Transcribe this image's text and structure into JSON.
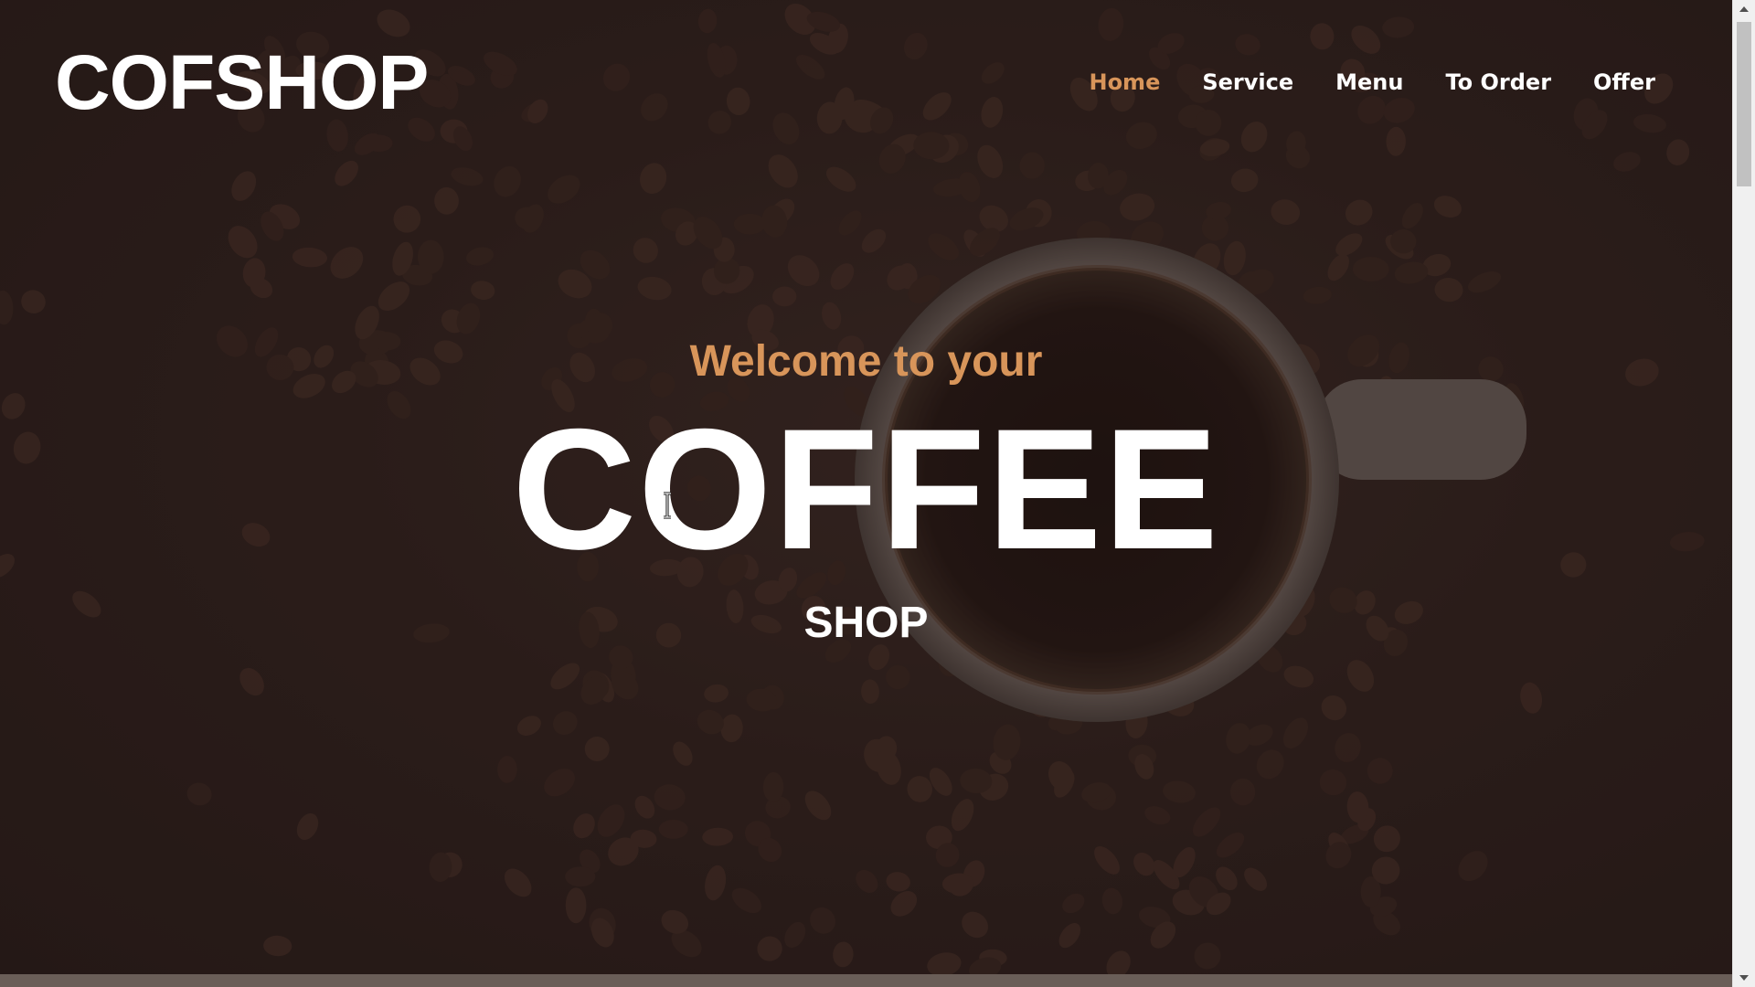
{
  "brand": {
    "logo_text": "COFSHOP"
  },
  "nav": {
    "items": [
      {
        "label": "Home",
        "active": true
      },
      {
        "label": "Service",
        "active": false
      },
      {
        "label": "Menu",
        "active": false
      },
      {
        "label": "To Order",
        "active": false
      },
      {
        "label": "Offer",
        "active": false
      }
    ]
  },
  "hero": {
    "welcome": "Welcome to your",
    "headline": "COFFEE",
    "subheadline": "SHOP"
  },
  "colors": {
    "accent": "#d8955a",
    "text_primary": "#ffffff",
    "background": "#2a1c1a",
    "strip": "#6a5e58"
  },
  "icons": {
    "cursor": "text-cursor-icon",
    "scroll_up": "scroll-up-arrow-icon",
    "scroll_down": "scroll-down-arrow-icon"
  }
}
